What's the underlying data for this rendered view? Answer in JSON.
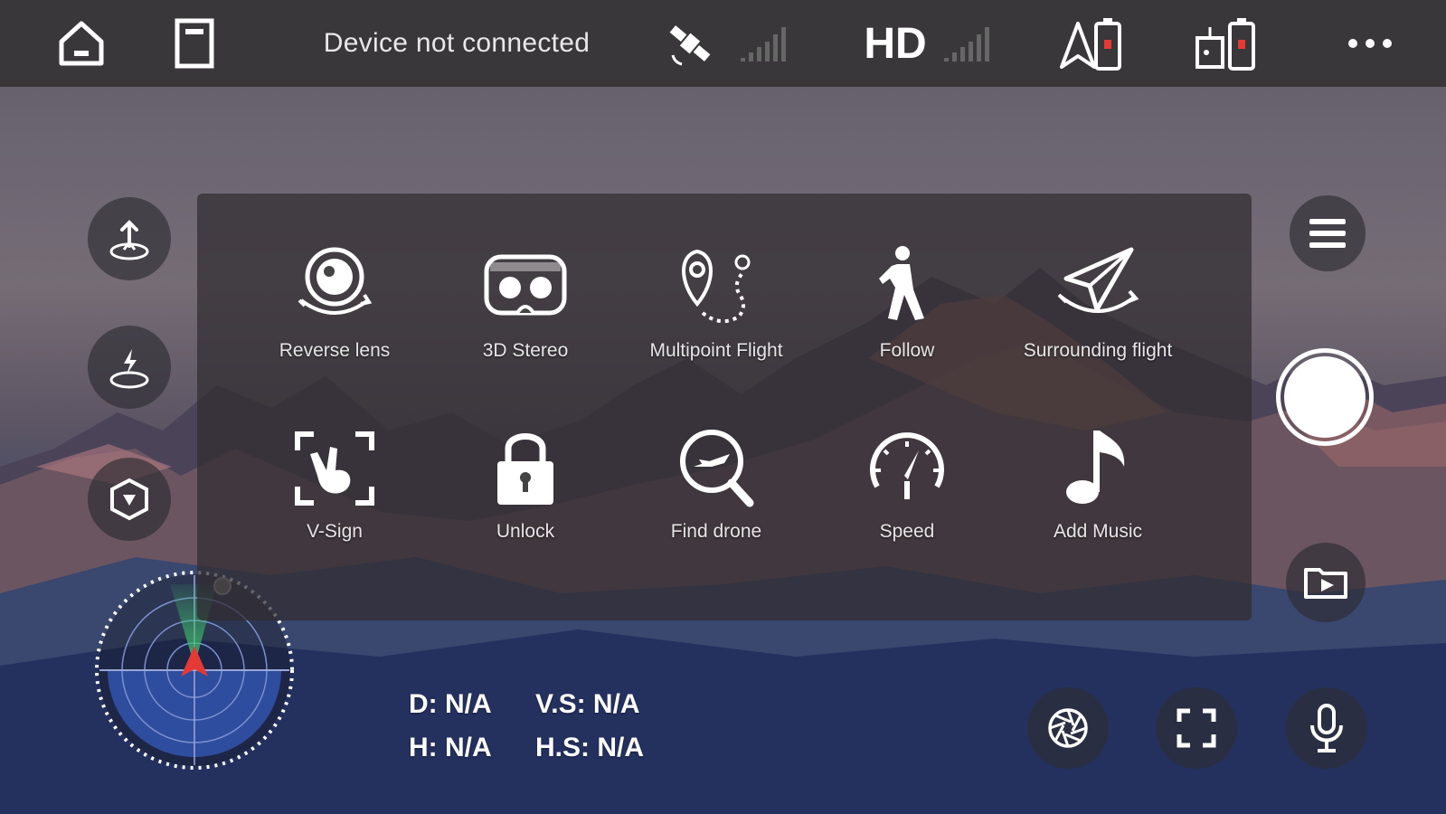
{
  "topbar": {
    "status": "Device not connected",
    "hd_label": "HD",
    "icons": [
      "home-icon",
      "sd-card-icon",
      "satellite-icon",
      "gps-signal-icon",
      "hd-signal-icon",
      "drone-battery-icon",
      "controller-battery-icon",
      "more-icon"
    ]
  },
  "left_controls": {
    "icons": [
      "takeoff-icon",
      "emergency-landing-icon",
      "headless-mode-icon"
    ]
  },
  "features": [
    {
      "label": "Reverse lens",
      "icon": "reverse-lens-icon"
    },
    {
      "label": "3D Stereo",
      "icon": "vr-glasses-icon"
    },
    {
      "label": "Multipoint Flight",
      "icon": "multipoint-flight-icon"
    },
    {
      "label": "Follow",
      "icon": "follow-icon"
    },
    {
      "label": "Surrounding flight",
      "icon": "surrounding-flight-icon"
    },
    {
      "label": "V-Sign",
      "icon": "v-sign-icon"
    },
    {
      "label": "Unlock",
      "icon": "lock-icon"
    },
    {
      "label": "Find drone",
      "icon": "find-drone-icon"
    },
    {
      "label": "Speed",
      "icon": "speedometer-icon"
    },
    {
      "label": "Add Music",
      "icon": "music-note-icon"
    }
  ],
  "telemetry": {
    "d": "D: N/A",
    "vs": "V.S: N/A",
    "h": "H: N/A",
    "hs": "H.S: N/A"
  },
  "right_controls": {
    "icons": [
      "menu-icon",
      "capture-button",
      "gallery-icon"
    ]
  },
  "bottom_controls": {
    "icons": [
      "camera-settings-icon",
      "fullscreen-icon",
      "microphone-icon"
    ]
  },
  "colors": {
    "topbar": "#393739",
    "radar_fill": "#2f4d9e",
    "radar_cone": "#3ec46d",
    "drone_marker": "#e53935"
  }
}
